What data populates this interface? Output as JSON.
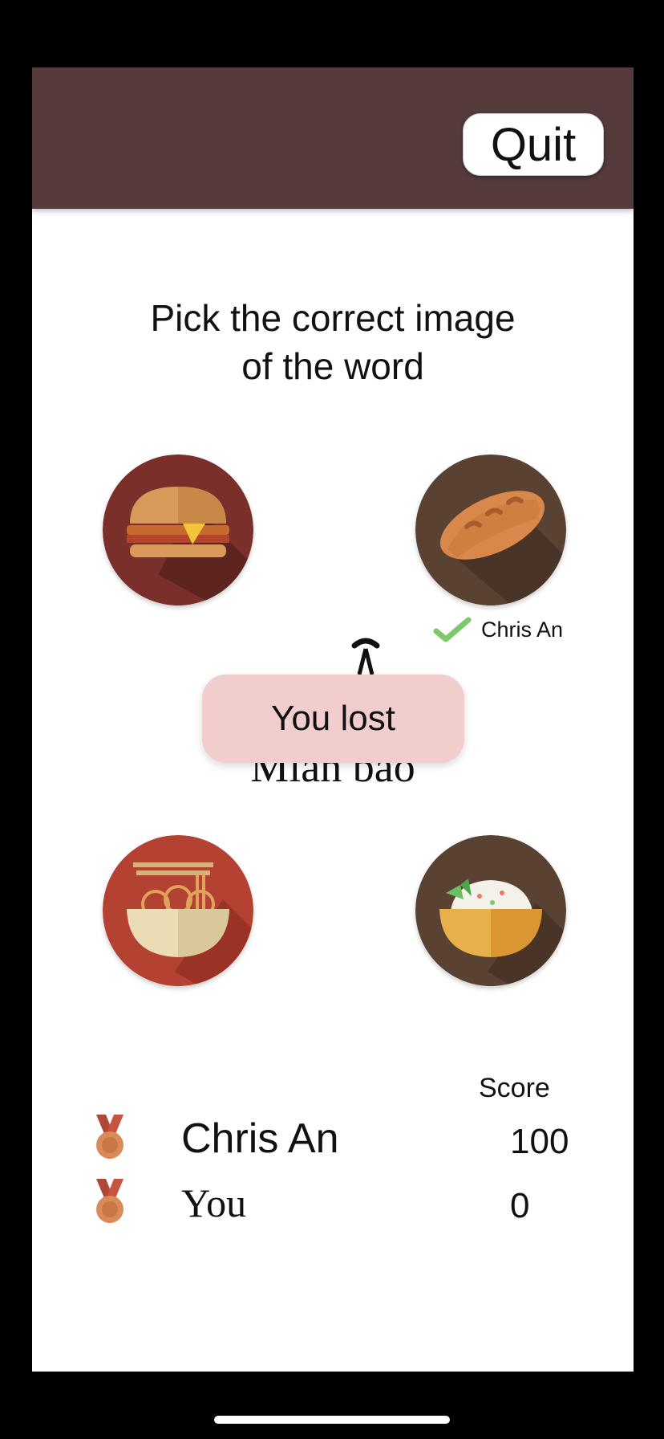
{
  "header": {
    "quit_label": "Quit"
  },
  "prompt": {
    "line1": "Pick the correct image",
    "line2": "of the word"
  },
  "choices": [
    {
      "icon": "burger-icon",
      "bg": "#7a2f2a"
    },
    {
      "icon": "bread-icon",
      "bg": "#5a4233"
    },
    {
      "icon": "noodle-bowl-icon",
      "bg": "#b34232"
    },
    {
      "icon": "rice-bowl-icon",
      "bg": "#5a4233"
    }
  ],
  "answer": {
    "player": "Chris An",
    "check_color": "#7bc96a"
  },
  "word": {
    "text": "Mian bao"
  },
  "toast": {
    "text": "You lost",
    "bg": "#f1cdcd"
  },
  "scoreboard": {
    "header": "Score",
    "players": [
      {
        "name": "Chris An",
        "score": "100",
        "medal": "bronze-medal-icon"
      },
      {
        "name": "You",
        "score": "0",
        "medal": "bronze-medal-icon"
      }
    ]
  },
  "colors": {
    "topbar": "#553b3c",
    "frame": "#000000"
  }
}
